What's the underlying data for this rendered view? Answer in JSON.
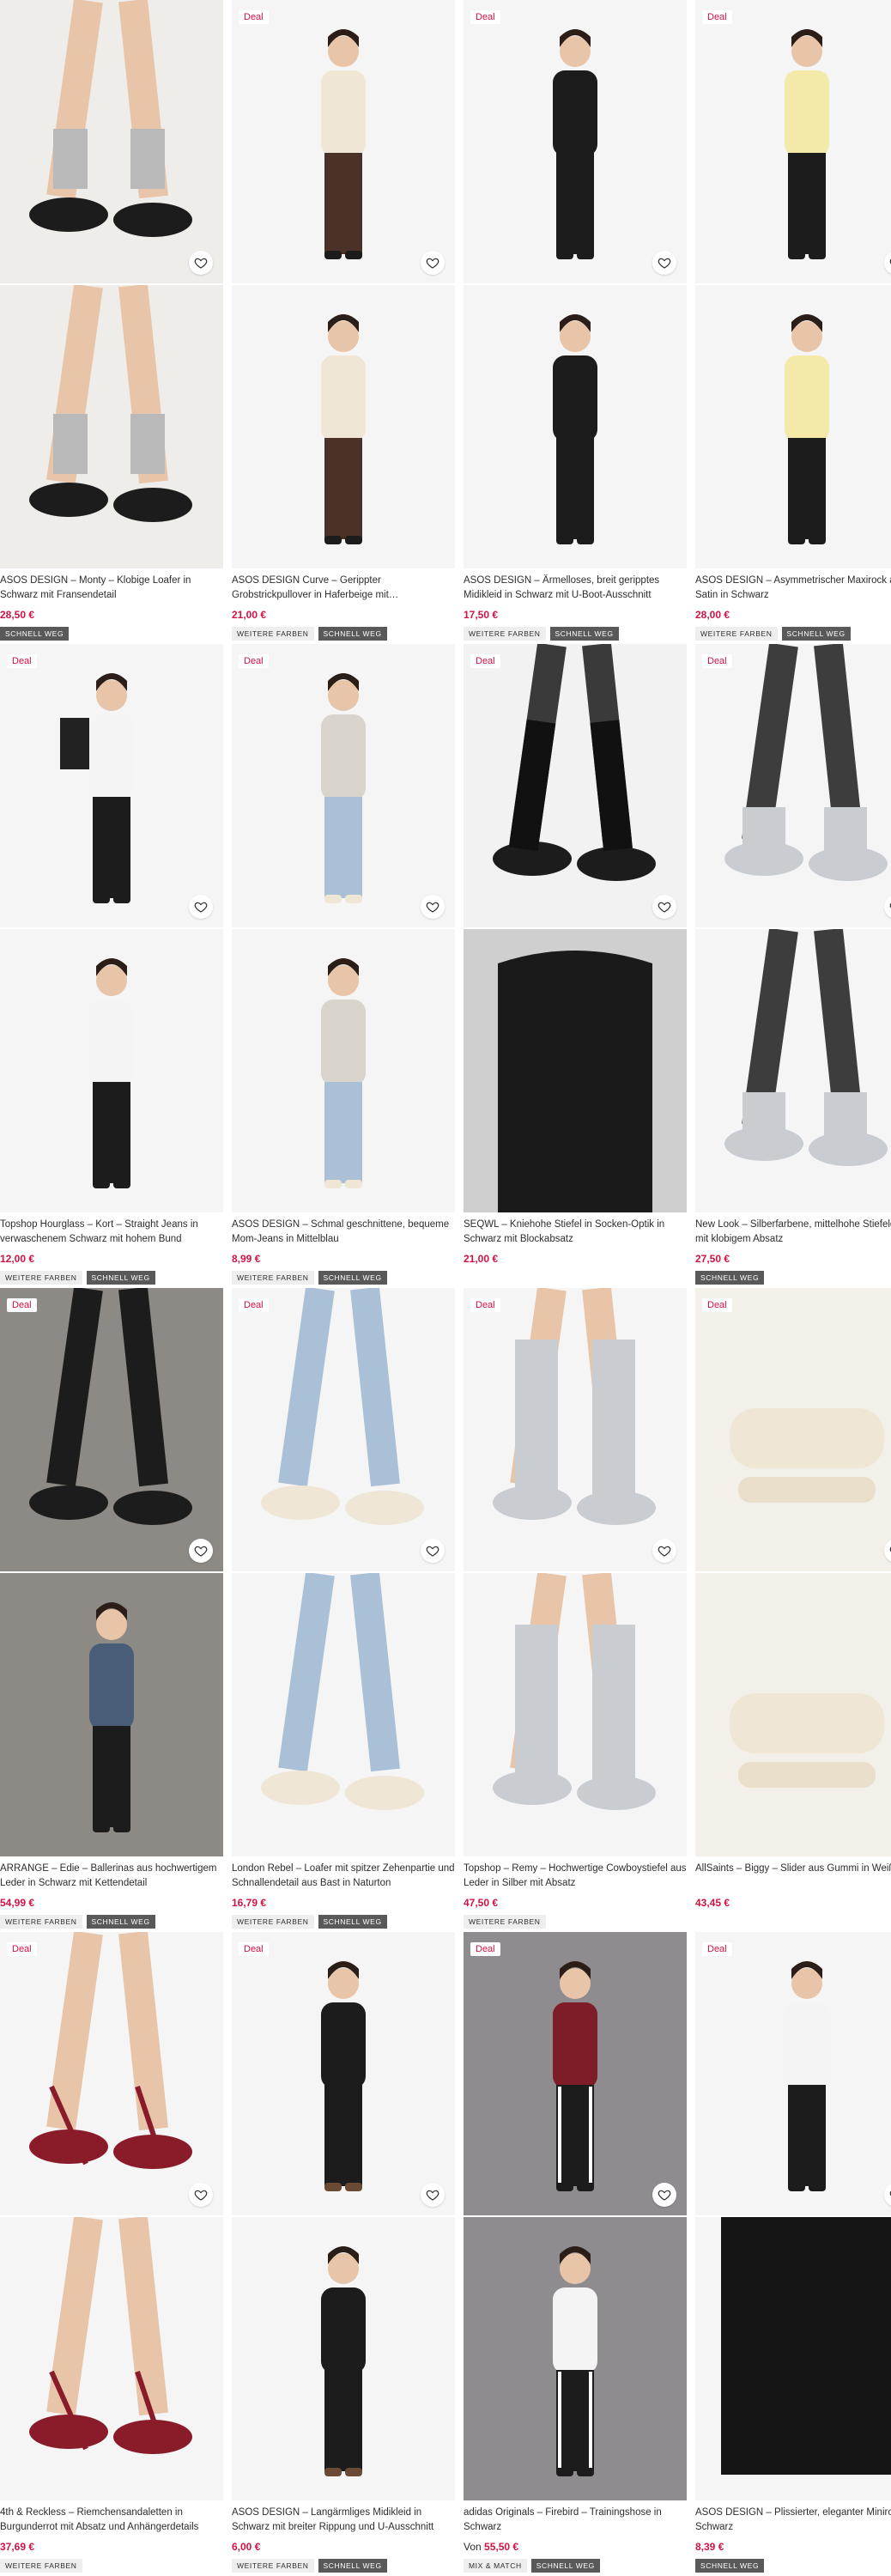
{
  "deal_label": "Deal",
  "colors": {
    "price": "#d01345",
    "deal_text": "#d01345",
    "tag_dark": "#595959",
    "tag_light": "#eeeeee"
  },
  "products": [
    {
      "title": "ASOS DESIGN – Monty – Klobige Loafer in Schwarz mit Fransendetail",
      "price": "28,50 €",
      "price_prefix": "",
      "deal": false,
      "tags": [
        {
          "label": "SCHNELL WEG",
          "style": "dark"
        }
      ],
      "bg": "#efedea",
      "images": [
        "legs-loafers-front",
        "legs-loafers-side"
      ]
    },
    {
      "title": "ASOS DESIGN Curve – Gerippter Grobstrickpullover in Haferbeige mit…",
      "price": "21,00 €",
      "price_prefix": "",
      "deal": true,
      "tags": [
        {
          "label": "WEITERE FARBEN",
          "style": "light"
        },
        {
          "label": "SCHNELL WEG",
          "style": "dark"
        }
      ],
      "bg": "#f5f5f5",
      "images": [
        "model-sweater-closeup",
        "model-sweater-full"
      ]
    },
    {
      "title": "ASOS DESIGN – Ärmelloses, breit geripptes Midikleid in Schwarz mit U-Boot-Ausschnitt",
      "price": "17,50 €",
      "price_prefix": "",
      "deal": true,
      "tags": [
        {
          "label": "WEITERE FARBEN",
          "style": "light"
        },
        {
          "label": "SCHNELL WEG",
          "style": "dark"
        }
      ],
      "bg": "#f5f5f5",
      "images": [
        "model-black-dress-front",
        "model-black-dress-back"
      ]
    },
    {
      "title": "ASOS DESIGN – Asymmetrischer Maxirock aus Satin in Schwarz",
      "price": "28,00 €",
      "price_prefix": "",
      "deal": true,
      "tags": [
        {
          "label": "WEITERE FARBEN",
          "style": "light"
        },
        {
          "label": "SCHNELL WEG",
          "style": "dark"
        }
      ],
      "bg": "#f5f5f5",
      "images": [
        "model-satin-skirt-front",
        "model-satin-skirt-side"
      ]
    },
    {
      "title": "Topshop Hourglass – Kort – Straight Jeans in verwaschenem Schwarz mit hohem Bund",
      "price": "12,00 €",
      "price_prefix": "",
      "deal": true,
      "tags": [
        {
          "label": "WEITERE FARBEN",
          "style": "light"
        },
        {
          "label": "SCHNELL WEG",
          "style": "dark"
        }
      ],
      "bg": "#f5f5f5",
      "images": [
        "model-black-jeans-front",
        "model-black-jeans-back"
      ]
    },
    {
      "title": "ASOS DESIGN – Schmal geschnittene, bequeme Mom-Jeans in Mittelblau",
      "price": "8,99 €",
      "price_prefix": "",
      "deal": true,
      "tags": [
        {
          "label": "WEITERE FARBEN",
          "style": "light"
        },
        {
          "label": "SCHNELL WEG",
          "style": "dark"
        }
      ],
      "bg": "#f5f5f5",
      "images": [
        "model-mom-jeans-front",
        "model-mom-jeans-back"
      ]
    },
    {
      "title": "SEQWL – Kniehohe Stiefel in Socken-Optik in Schwarz mit Blockabsatz",
      "price": "21,00 €",
      "price_prefix": "",
      "deal": true,
      "tags": [],
      "bg": "#f2f2f2",
      "images": [
        "legs-knee-boots",
        "boot-closeup"
      ]
    },
    {
      "title": "New Look – Silberfarbene, mittelhohe Stiefelette mit klobigem Absatz",
      "price": "27,50 €",
      "price_prefix": "",
      "deal": true,
      "tags": [
        {
          "label": "SCHNELL WEG",
          "style": "dark"
        }
      ],
      "bg": "#f5f5f5",
      "images": [
        "legs-silver-ankle-boots",
        "silver-ankle-boots-detail"
      ]
    },
    {
      "title": "ARRANGE – Edie – Ballerinas aus hochwertigem Leder in Schwarz mit Kettendetail",
      "price": "54,99 €",
      "price_prefix": "",
      "deal": true,
      "tags": [
        {
          "label": "WEITERE FARBEN",
          "style": "light"
        },
        {
          "label": "SCHNELL WEG",
          "style": "dark"
        }
      ],
      "bg": "#8d8a86",
      "images": [
        "legs-ballerinas",
        "model-black-trousers"
      ]
    },
    {
      "title": "London Rebel – Loafer mit spitzer Zehenpartie und Schnallendetail aus Bast in Naturton",
      "price": "16,79 €",
      "price_prefix": "",
      "deal": true,
      "tags": [
        {
          "label": "WEITERE FARBEN",
          "style": "light"
        },
        {
          "label": "SCHNELL WEG",
          "style": "dark"
        }
      ],
      "bg": "#f5f5f5",
      "images": [
        "legs-cream-loafers",
        "legs-cream-loafers-side"
      ]
    },
    {
      "title": "Topshop – Remy – Hochwertige Cowboystiefel aus Leder in Silber mit Absatz",
      "price": "47,50 €",
      "price_prefix": "",
      "deal": true,
      "tags": [
        {
          "label": "WEITERE FARBEN",
          "style": "light"
        }
      ],
      "bg": "#f5f5f5",
      "images": [
        "legs-silver-cowboy-boots",
        "silver-cowboy-boot"
      ]
    },
    {
      "title": "AllSaints – Biggy – Slider aus Gummi in Weiß",
      "price": "43,45 €",
      "price_prefix": "",
      "deal": true,
      "tags": [],
      "bg": "#f3efe9",
      "images": [
        "feet-slides",
        "slide-product"
      ],
      "tall": true
    },
    {
      "title": "4th & Reckless – Riemchensandaletten in Burgunderrot mit Absatz und Anhängerdetails",
      "price": "37,69 €",
      "price_prefix": "",
      "deal": true,
      "tags": [
        {
          "label": "WEITERE FARBEN",
          "style": "light"
        }
      ],
      "bg": "#f5f5f5",
      "images": [
        "feet-red-sandals",
        "red-sandal-closeup"
      ]
    },
    {
      "title": "ASOS DESIGN – Langärmliges Midikleid in Schwarz mit breiter Rippung und U-Ausschnitt",
      "price": "6,00 €",
      "price_prefix": "",
      "deal": true,
      "tags": [
        {
          "label": "WEITERE FARBEN",
          "style": "light"
        },
        {
          "label": "SCHNELL WEG",
          "style": "dark"
        }
      ],
      "bg": "#f5f5f5",
      "images": [
        "model-longsleeve-dress",
        "model-longsleeve-dress-side"
      ]
    },
    {
      "title": "adidas Originals – Firebird – Trainingshose in Schwarz",
      "price": "55,50 €",
      "price_prefix": "Von",
      "deal": true,
      "tags": [
        {
          "label": "MIX & MATCH",
          "style": "light"
        },
        {
          "label": "SCHNELL WEG",
          "style": "dark"
        }
      ],
      "bg": "#8e8c8f",
      "images": [
        "model-track-pants-jacket",
        "model-track-pants-tee"
      ]
    },
    {
      "title": "ASOS DESIGN – Plissierter, eleganter Minirock in Schwarz",
      "price": "8,39 €",
      "price_prefix": "",
      "deal": true,
      "tags": [
        {
          "label": "SCHNELL WEG",
          "style": "dark"
        }
      ],
      "bg": "#f5f5f5",
      "images": [
        "model-mini-skirt",
        "mini-skirt-closeup"
      ]
    }
  ]
}
